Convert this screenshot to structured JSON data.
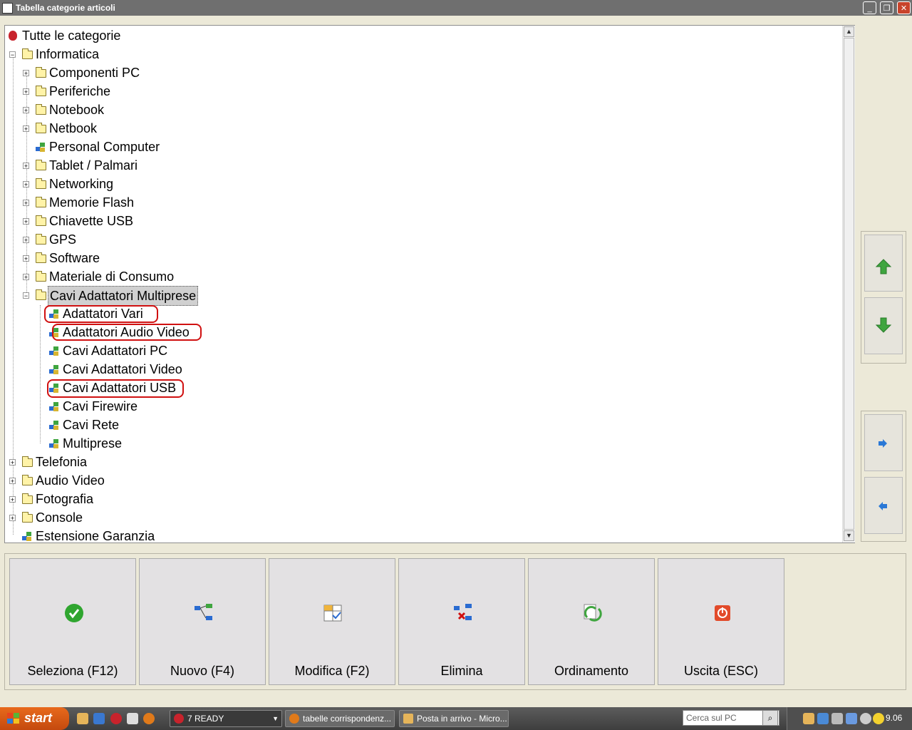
{
  "window": {
    "title": "Tabella categorie articoli"
  },
  "tree": {
    "root": "Tutte le categorie",
    "informatica": {
      "label": "Informatica",
      "children": [
        "Componenti PC",
        "Periferiche",
        "Notebook",
        "Netbook",
        "Personal Computer",
        "Tablet / Palmari",
        "Networking",
        "Memorie Flash",
        "Chiavette USB",
        "GPS",
        "Software",
        "Materiale di Consumo"
      ]
    },
    "cavi": {
      "label": "Cavi Adattatori Multiprese",
      "children": [
        "Adattatori Vari",
        "Adattatori Audio Video",
        "Cavi Adattatori PC",
        "Cavi Adattatori Video",
        "Cavi Adattatori USB",
        "Cavi Firewire",
        "Cavi Rete",
        "Multiprese"
      ]
    },
    "others": [
      "Telefonia",
      "Audio Video",
      "Fotografia",
      "Console",
      "Estensione Garanzia"
    ]
  },
  "toolbar": {
    "select": "Seleziona (F12)",
    "new": "Nuovo (F4)",
    "edit": "Modifica (F2)",
    "delete": "Elimina",
    "order": "Ordinamento",
    "exit": "Uscita (ESC)"
  },
  "taskbar": {
    "start": "start",
    "tasks": [
      "7 READY",
      "tabelle corrispondenz...",
      "Posta in arrivo - Micro..."
    ],
    "search_placeholder": "Cerca sul PC",
    "clock": "9.06"
  },
  "colors": {
    "accent_green": "#3fa53f",
    "circle_red": "#d01010",
    "arrow_blue": "#2a78d6"
  }
}
